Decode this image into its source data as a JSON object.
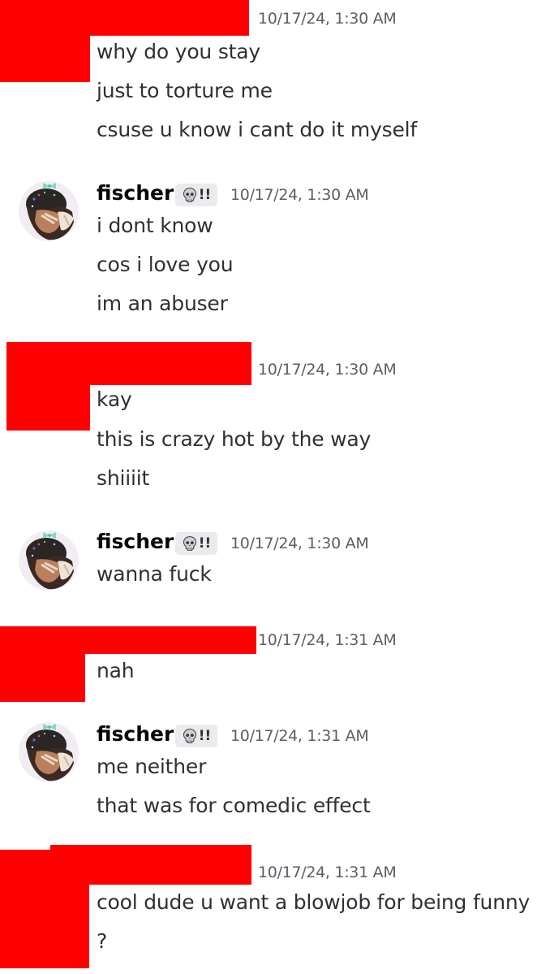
{
  "messages": [
    {
      "author": "",
      "redacted": true,
      "timestamp": "10/17/24, 1:30 AM",
      "lines": [
        "why do you stay",
        "just to torture me",
        "csuse u know i cant do it myself"
      ]
    },
    {
      "author": "fischer",
      "redacted": false,
      "tag": "!!",
      "tag_icon": "skull-icon",
      "timestamp": "10/17/24, 1:30 AM",
      "lines": [
        "i dont know",
        "cos i love you",
        "im an abuser"
      ]
    },
    {
      "author": "",
      "redacted": true,
      "timestamp": "10/17/24, 1:30 AM",
      "lines": [
        "kay",
        "this is crazy hot by the way",
        "shiiiit"
      ]
    },
    {
      "author": "fischer",
      "redacted": false,
      "tag": "!!",
      "tag_icon": "skull-icon",
      "timestamp": "10/17/24, 1:30 AM",
      "lines": [
        "wanna fuck"
      ]
    },
    {
      "author": "",
      "redacted": true,
      "timestamp": "10/17/24, 1:31 AM",
      "lines": [
        "nah"
      ]
    },
    {
      "author": "fischer",
      "redacted": false,
      "tag": "!!",
      "tag_icon": "skull-icon",
      "timestamp": "10/17/24, 1:31 AM",
      "lines": [
        "me neither",
        "that was for comedic effect"
      ]
    },
    {
      "author": "",
      "redacted": true,
      "timestamp": "10/17/24, 1:31 AM",
      "lines": [
        "cool dude u want a blowjob for being funny",
        "?"
      ]
    }
  ],
  "colors": {
    "redaction": "#ff0000",
    "text": "#2e3035",
    "timestamp": "#5c5e66",
    "username": "#060607",
    "tag_bg": "#ebebed"
  }
}
